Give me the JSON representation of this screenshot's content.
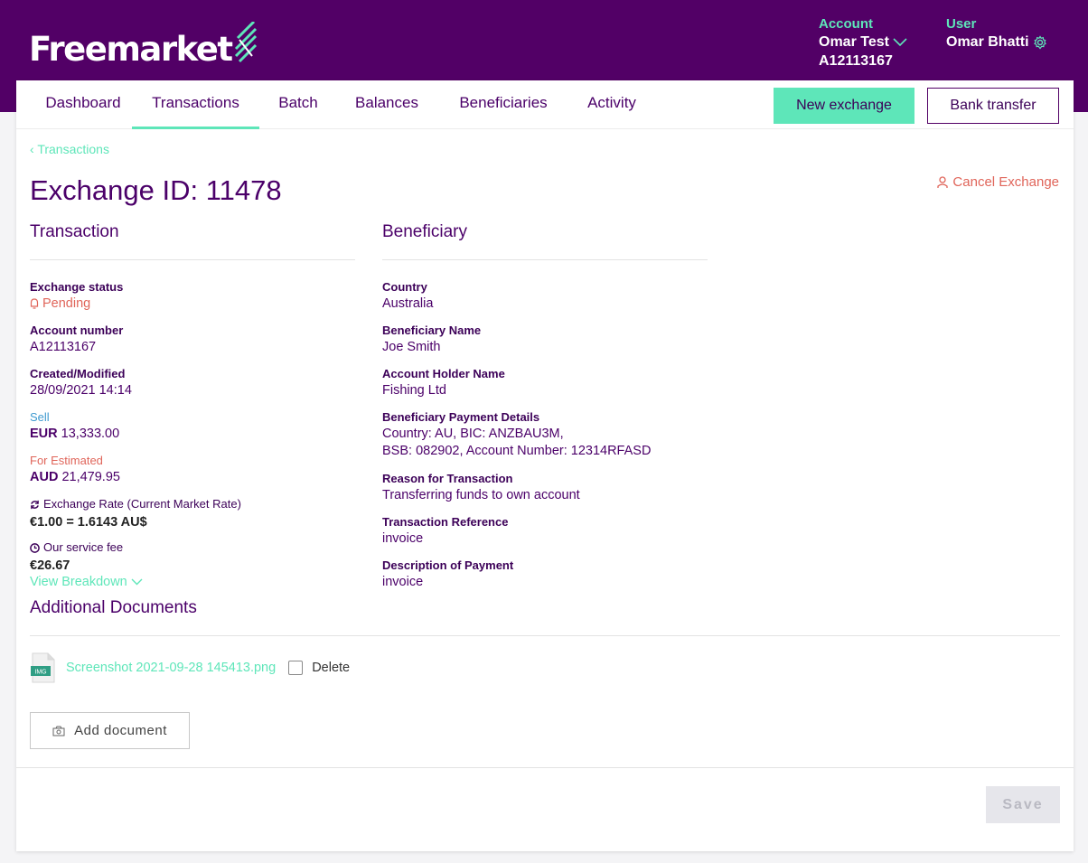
{
  "header": {
    "logo_text": "Freemarket",
    "account_label": "Account",
    "account_name": "Omar Test",
    "account_number": "A12113167",
    "user_label": "User",
    "user_name": "Omar Bhatti"
  },
  "nav": {
    "items": [
      "Dashboard",
      "Transactions",
      "Batch",
      "Balances",
      "Beneficiaries",
      "Activity"
    ],
    "active": "Transactions",
    "new_exchange": "New exchange",
    "bank_transfer": "Bank transfer"
  },
  "page": {
    "breadcrumb": "Transactions",
    "title": "Exchange ID: 11478",
    "cancel": "Cancel Exchange"
  },
  "transaction": {
    "heading": "Transaction",
    "status_label": "Exchange status",
    "status_value": "Pending",
    "account_label": "Account number",
    "account_value": "A12113167",
    "created_label": "Created/Modified",
    "created_value": "28/09/2021 14:14",
    "sell_label": "Sell",
    "sell_currency": "EUR",
    "sell_amount": "13,333.00",
    "for_label": "For Estimated",
    "for_currency": "AUD",
    "for_amount": "21,479.95",
    "rate_label": "Exchange Rate (Current Market Rate)",
    "rate_value": "€1.00 = 1.6143 AU$",
    "fee_label": "Our service fee",
    "fee_value": "€26.67",
    "breakdown": "View Breakdown"
  },
  "beneficiary": {
    "heading": "Beneficiary",
    "country_label": "Country",
    "country_value": "Australia",
    "name_label": "Beneficiary Name",
    "name_value": "Joe Smith",
    "holder_label": "Account Holder Name",
    "holder_value": "Fishing Ltd",
    "payment_label": "Beneficiary Payment Details",
    "payment_line1": "Country: AU, BIC: ANZBAU3M,",
    "payment_line2": "BSB: 082902, Account Number: 12314RFASD",
    "reason_label": "Reason for Transaction",
    "reason_value": "Transferring funds to own account",
    "ref_label": "Transaction Reference",
    "ref_value": "invoice",
    "desc_label": "Description of Payment",
    "desc_value": "invoice"
  },
  "documents": {
    "heading": "Additional Documents",
    "file_badge": "IMG",
    "file_name": "Screenshot 2021-09-28 145413.png",
    "delete_label": "Delete",
    "add_label": "Add document"
  },
  "footer": {
    "save_label": "Save"
  },
  "colors": {
    "brand_purple": "#520066",
    "accent_green": "#5ee6b9",
    "warning_orange": "#e0655a"
  }
}
